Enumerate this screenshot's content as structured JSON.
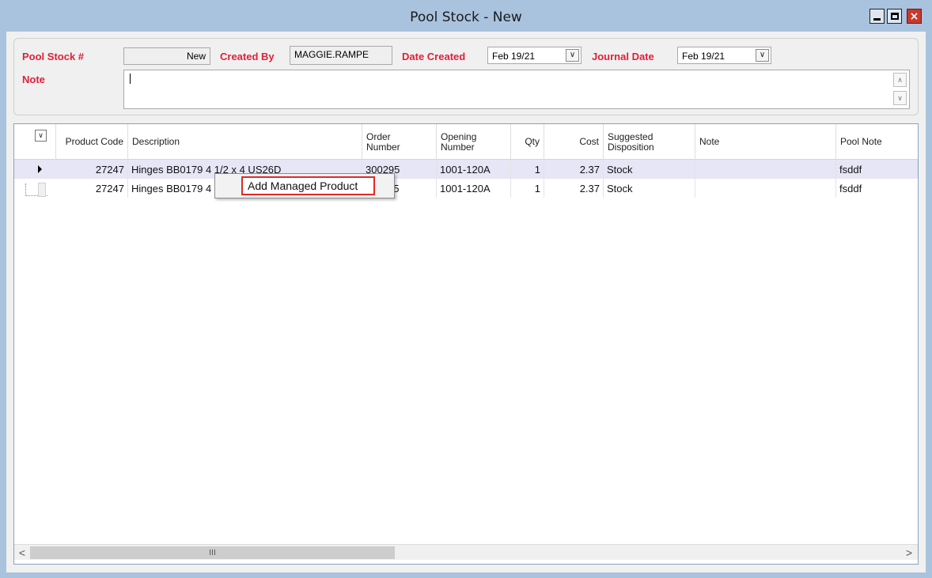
{
  "window": {
    "title": "Pool Stock - New",
    "controls": {
      "minimize": "minimize-icon",
      "maximize": "maximize-icon",
      "close": "×"
    }
  },
  "header": {
    "pool_stock_label": "Pool Stock #",
    "pool_stock_value": "New",
    "created_by_label": "Created By",
    "created_by_value": "MAGGIE.RAMPE",
    "date_created_label": "Date Created",
    "date_created_value": "Feb 19/21",
    "journal_date_label": "Journal Date",
    "journal_date_value": "Feb 19/21",
    "note_label": "Note",
    "note_value": ""
  },
  "grid": {
    "columns": {
      "product_code": "Product Code",
      "description": "Description",
      "order_number_1": "Order",
      "order_number_2": "Number",
      "opening_number_1": "Opening",
      "opening_number_2": "Number",
      "qty": "Qty",
      "cost": "Cost",
      "suggested_disposition_1": "Suggested",
      "suggested_disposition_2": "Disposition",
      "note": "Note",
      "pool_note": "Pool Note"
    },
    "rows": [
      {
        "product_code": "27247",
        "description": "Hinges BB0179 4 1/2 x 4 US26D",
        "order_number": "300295",
        "opening_number": "1001-120A",
        "qty": "1",
        "cost": "2.37",
        "suggested_disposition": "Stock",
        "note": "",
        "pool_note": "fsddf"
      },
      {
        "product_code": "27247",
        "description": "Hinges BB0179 4",
        "order_number": "95",
        "opening_number": "1001-120A",
        "qty": "1",
        "cost": "2.37",
        "suggested_disposition": "Stock",
        "note": "",
        "pool_note": "fsddf"
      }
    ]
  },
  "context_menu": {
    "add_managed_product": "Add Managed Product"
  },
  "scrollbar": {
    "left": "<",
    "right": ">",
    "thumb_grip": "III"
  },
  "colors": {
    "label_red": "#e0203a",
    "selected_row": "#e6e6f7",
    "highlight_border": "#e02a2a",
    "frame": "#a9c3de"
  }
}
